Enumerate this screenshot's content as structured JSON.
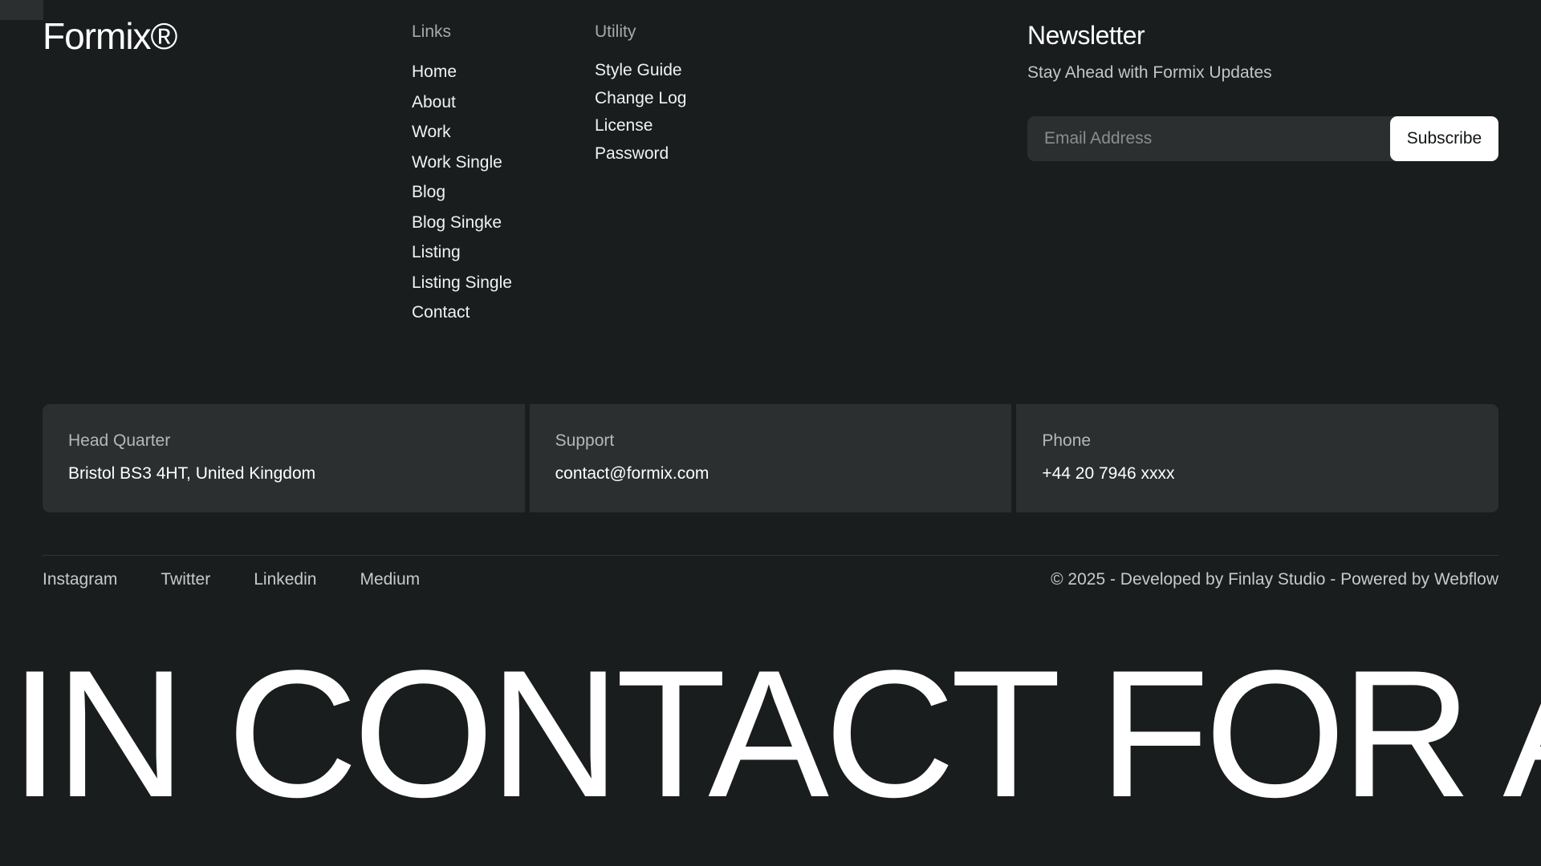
{
  "brand": {
    "name": "Formix®"
  },
  "links": {
    "title": "Links",
    "items": [
      "Home",
      "About",
      "Work",
      "Work Single",
      "Blog",
      "Blog Singke",
      "Listing",
      "Listing Single",
      "Contact"
    ]
  },
  "utility": {
    "title": "Utility",
    "items": [
      "Style Guide",
      "Change Log",
      "License",
      "Password"
    ]
  },
  "newsletter": {
    "title": "Newsletter",
    "subtitle": "Stay Ahead with Formix Updates",
    "email_placeholder": "Email Address",
    "email_value": "",
    "subscribe_label": "Subscribe"
  },
  "contact": {
    "headquarter": {
      "label": "Head Quarter",
      "value": "Bristol BS3 4HT, United Kingdom"
    },
    "support": {
      "label": "Support",
      "value": "contact@formix.com"
    },
    "phone": {
      "label": "Phone",
      "value": "+44 20 7946 xxxx"
    }
  },
  "social": {
    "items": [
      "Instagram",
      "Twitter",
      "Linkedin",
      "Medium"
    ]
  },
  "copyright": "© 2025 - Developed by Finlay Studio - Powered by Webflow",
  "marquee_text": "IN CONTACT FOR A",
  "colors": {
    "background": "#1a1d1d",
    "card": "#2b2f2f",
    "text": "#ffffff",
    "muted": "#a6aaaa",
    "button_bg": "#ffffff",
    "button_text": "#111414"
  }
}
